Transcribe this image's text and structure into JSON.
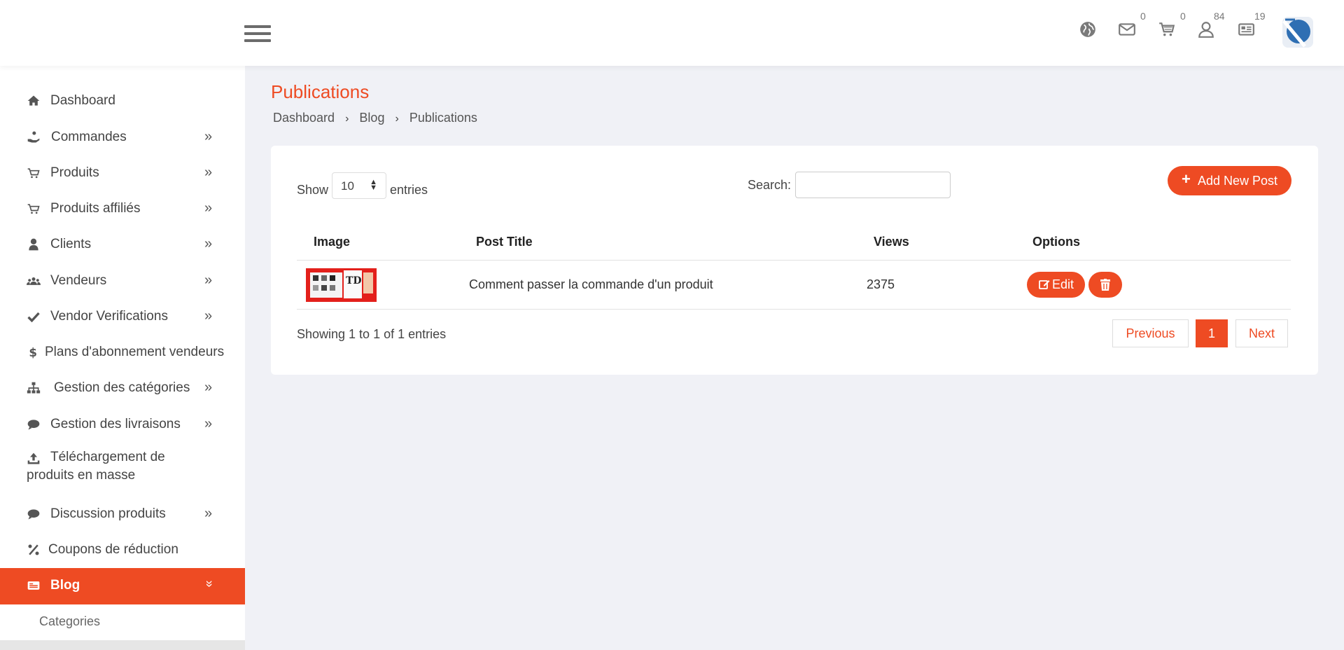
{
  "header": {
    "counts": {
      "messages": "0",
      "cart": "0",
      "users": "84",
      "news": "19"
    }
  },
  "sidebar": {
    "items": [
      {
        "label": "Dashboard",
        "icon": "home-icon"
      },
      {
        "label": "Commandes",
        "icon": "hand-coin-icon"
      },
      {
        "label": "Produits",
        "icon": "cart-icon"
      },
      {
        "label": "Produits affiliés",
        "icon": "cart-icon"
      },
      {
        "label": "Clients",
        "icon": "user-icon"
      },
      {
        "label": "Vendeurs",
        "icon": "users-icon"
      },
      {
        "label": "Vendor Verifications",
        "icon": "check-icon"
      },
      {
        "label": "Plans d'abonnement vendeurs",
        "icon": "dollar-icon"
      },
      {
        "label": "Gestion des catégories",
        "icon": "sitemap-icon"
      },
      {
        "label": "Gestion des livraisons",
        "icon": "chat-icon"
      },
      {
        "label_line1": "Téléchargement de",
        "label_line2": "produits en masse",
        "icon": "upload-icon"
      },
      {
        "label": "Discussion produits",
        "icon": "chat-icon"
      },
      {
        "label": "Coupons de réduction",
        "icon": "percent-icon"
      },
      {
        "label": "Blog",
        "icon": "newspaper-icon"
      }
    ],
    "submenu": [
      {
        "label": "Categories"
      }
    ],
    "accent": "#ee4b23"
  },
  "page": {
    "title": "Publications",
    "breadcrumb": [
      "Dashboard",
      "Blog",
      "Publications"
    ]
  },
  "table": {
    "show_label": "Show",
    "entries_value": "10",
    "entries_label": "entries",
    "search_label": "Search:",
    "search_value": "",
    "add_button": "Add New Post",
    "columns": [
      "Image",
      "Post Title",
      "Views",
      "Options"
    ],
    "rows": [
      {
        "title": "Comment passer la commande d'un produit",
        "views": "2375",
        "edit": "Edit"
      }
    ],
    "info": "Showing 1 to 1 of 1 entries",
    "pagination": {
      "previous": "Previous",
      "current": "1",
      "next": "Next"
    }
  }
}
